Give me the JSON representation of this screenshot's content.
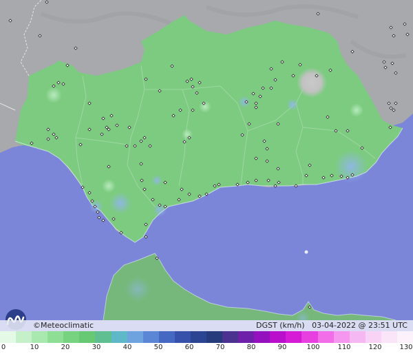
{
  "map": {
    "attribution": "©Meteoclimatic",
    "variable_label": "DGST (km/h)",
    "timestamp": "03-04-2022 @ 23:51 UTC",
    "colors": {
      "sea": "#7b86d8",
      "land_outside": "#a7a8ab",
      "region_fill": "#7ccb80",
      "africa_fill": "#76b87c",
      "high_peak": "#c9c9c9",
      "station_marker": "#222222"
    }
  },
  "legend": {
    "unit": "km/h",
    "min": 0,
    "max": 130,
    "tick_labels": [
      "0",
      "10",
      "20",
      "30",
      "40",
      "50",
      "60",
      "70",
      "80",
      "90",
      "100",
      "110",
      "120",
      "130"
    ],
    "colors": [
      "#e4f9e6",
      "#c6f0c9",
      "#a9e8ae",
      "#8ede95",
      "#77d37f",
      "#67c973",
      "#5fbf90",
      "#5fb8c7",
      "#6ea3e0",
      "#5b86d6",
      "#4568c2",
      "#3551aa",
      "#2c4592",
      "#263b7c",
      "#4b3190",
      "#6e20a8",
      "#9511bf",
      "#b90fcc",
      "#d61bd6",
      "#e83fe0",
      "#f26de8",
      "#f597ee",
      "#f6b8f2",
      "#f8d3f6",
      "#fae4f8",
      "#fcf2fb"
    ]
  }
}
